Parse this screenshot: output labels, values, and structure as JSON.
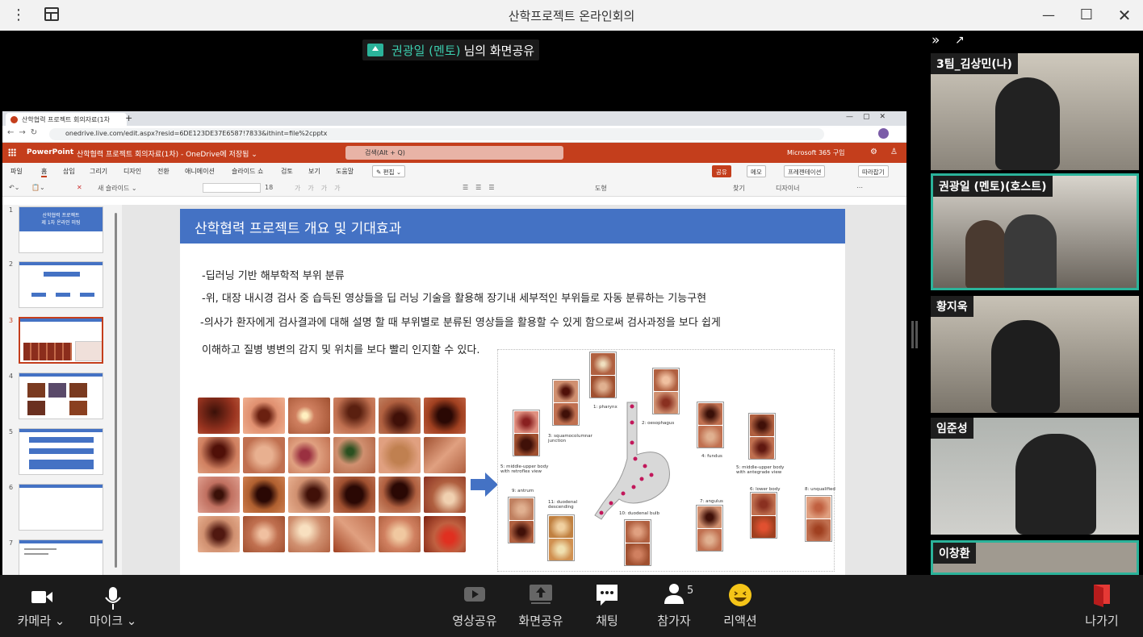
{
  "window": {
    "title": "산학프로젝트 온라인회의"
  },
  "share_banner": {
    "presenter": "권광일 (멘토)",
    "suffix": "님의 화면공유"
  },
  "browser": {
    "tab_title": "산학협력 프로젝트 회의자료(1차",
    "url": "onedrive.live.com/edit.aspx?resid=6DE123DE37E6587!7833&ithint=file%2cpptx"
  },
  "powerpoint": {
    "app": "PowerPoint",
    "file": "산학협력 프로젝트 회의자료(1차) - OneDrive에 저장됨 ⌄",
    "search": "검색(Alt + Q)",
    "ms365": "Microsoft 365 구입",
    "menu": [
      "파일",
      "홈",
      "삽입",
      "그리기",
      "디자인",
      "전환",
      "애니메이션",
      "슬라이드 쇼",
      "검토",
      "보기",
      "도움말"
    ],
    "edit_btn": "✎ 편집 ⌄",
    "share_btn": "공유",
    "memo_btn": "메모",
    "present_btn": "프레젠테이션",
    "follow_btn": "따라잡기",
    "tool_new_slide": "새 슬라이드 ⌄",
    "tool_find": "찾기",
    "tool_designer": "디자이너",
    "tool_shape": "도형",
    "font_size": "18",
    "thumbs": [
      {
        "num": "1",
        "title": "산학협력 프로젝트",
        "subtitle": "제 1차 온라인 미팅"
      },
      {
        "num": "2"
      },
      {
        "num": "3"
      },
      {
        "num": "4"
      },
      {
        "num": "5"
      },
      {
        "num": "6"
      },
      {
        "num": "7"
      }
    ]
  },
  "slide": {
    "title": "산학협력 프로젝트 개요 및 기대효과",
    "bullets": [
      "-딥러닝 기반 해부학적 부위 분류",
      "-위, 대장 내시경 검사 중 습득된 영상들을 딥 러닝 기술을 활용해 장기내 세부적인 부위들로 자동 분류하는 기능구현",
      "-의사가 환자에게 검사결과에 대해 설명 할 때 부위별로 분류된 영상들을 활용할 수 있게 함으로써 검사과정을 보다 쉽게",
      " 이해하고 질병 병변의 감지 및 위치를 보다 빨리 인지할 수 있다."
    ],
    "diagram_labels": [
      "1: pharynx",
      "2: oesophagus",
      "3: squamocolumnar junction",
      "4: fundus",
      "5: middle-upper body with retroflex view",
      "5: middle-upper body with antegrade view",
      "6: lower body",
      "7: angulus",
      "8: unqualified",
      "9: antrum",
      "10: duodenal bulb",
      "11: duodenal descending"
    ]
  },
  "participants": [
    {
      "name": "3팀_김상민(나)",
      "active": false
    },
    {
      "name": "권광일 (멘토)(호스트)",
      "active": true
    },
    {
      "name": "황지욱",
      "active": false
    },
    {
      "name": "임준성",
      "active": false
    },
    {
      "name": "이창환",
      "active": true
    }
  ],
  "toolbar": {
    "camera": "카메라 ⌄",
    "mic": "마이크 ⌄",
    "video_share": "영상공유",
    "screen_share": "화면공유",
    "chat": "채팅",
    "participants": "참가자",
    "participant_count": "5",
    "reaction": "리액션",
    "leave": "나가기"
  }
}
